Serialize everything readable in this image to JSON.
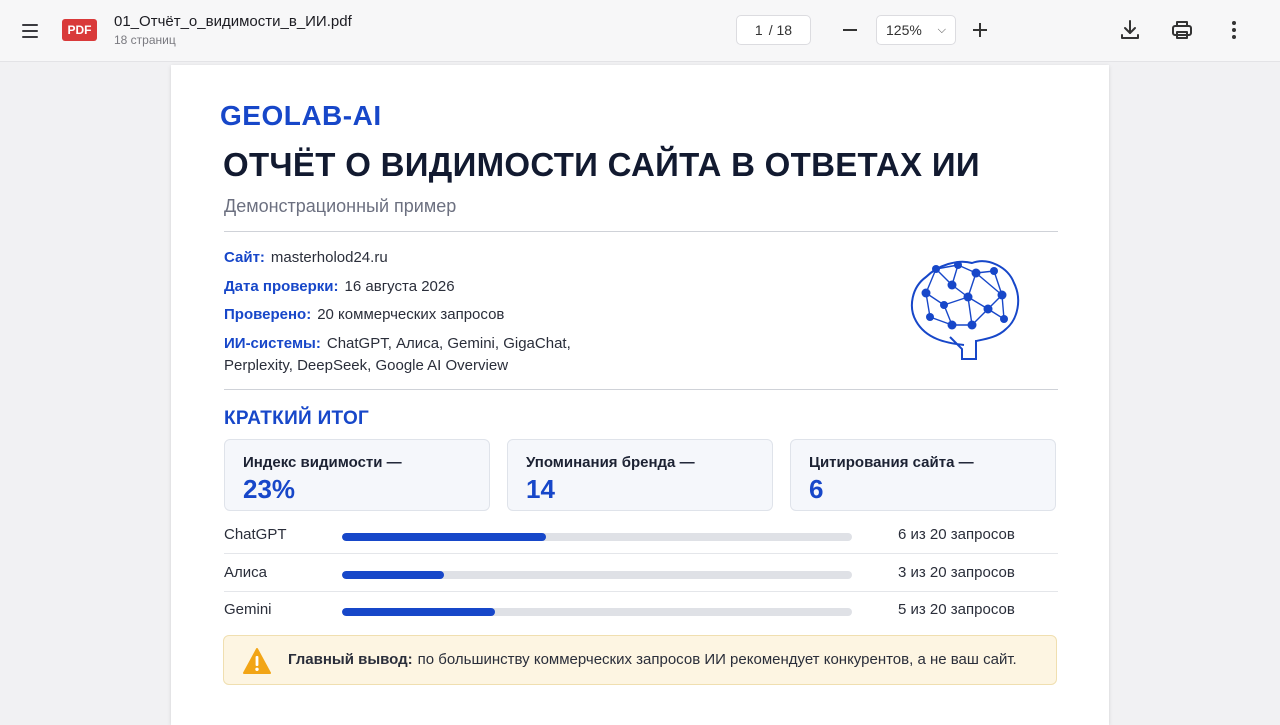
{
  "toolbar": {
    "file_badge": "PDF",
    "file_name": "01_Отчёт_о_видимости_в_ИИ.pdf",
    "file_pages": "18 страниц",
    "page_current": "1",
    "page_total": "/ 18",
    "zoom": "125%"
  },
  "report": {
    "brand": "GEOLAB-AI",
    "title": "ОТЧЁТ О ВИДИМОСТИ САЙТА В ОТВЕТАХ ИИ",
    "subtitle": "Демонстрационный пример",
    "meta": {
      "site_label": "Сайт:",
      "site_value": "masterholod24.ru",
      "date_label": "Дата проверки:",
      "date_value": "16 августа 2026",
      "checked_label": "Проверено:",
      "checked_value": "20 коммерческих запросов",
      "systems_label": "ИИ-системы:",
      "systems_value_line1": "ChatGPT, Алиса, Gemini, GigaChat,",
      "systems_value_line2": "Perplexity, DeepSeek, Google AI Overview"
    },
    "summary_title": "КРАТКИЙ ИТОГ",
    "cards": [
      {
        "label": "Индекс видимости —",
        "value": "23%"
      },
      {
        "label": "Упоминания бренда —",
        "value": "14"
      },
      {
        "label": "Цитирования сайта —",
        "value": "6"
      }
    ],
    "rows": [
      {
        "name": "ChatGPT",
        "text": "6 из 20 запросов",
        "share": 0.4
      },
      {
        "name": "Алиса",
        "text": "3 из 20 запросов",
        "share": 0.2
      },
      {
        "name": "Gemini",
        "text": "5 из 20 запросов",
        "share": 0.3
      }
    ],
    "alert": {
      "label": "Главный вывод:",
      "text": "по большинству коммерческих запросов ИИ рекомендует конкурентов, а не ваш сайт."
    }
  },
  "colors": {
    "accent": "#1747c9",
    "pdf_badge": "#d93a3a",
    "warning": "#f2a516"
  }
}
